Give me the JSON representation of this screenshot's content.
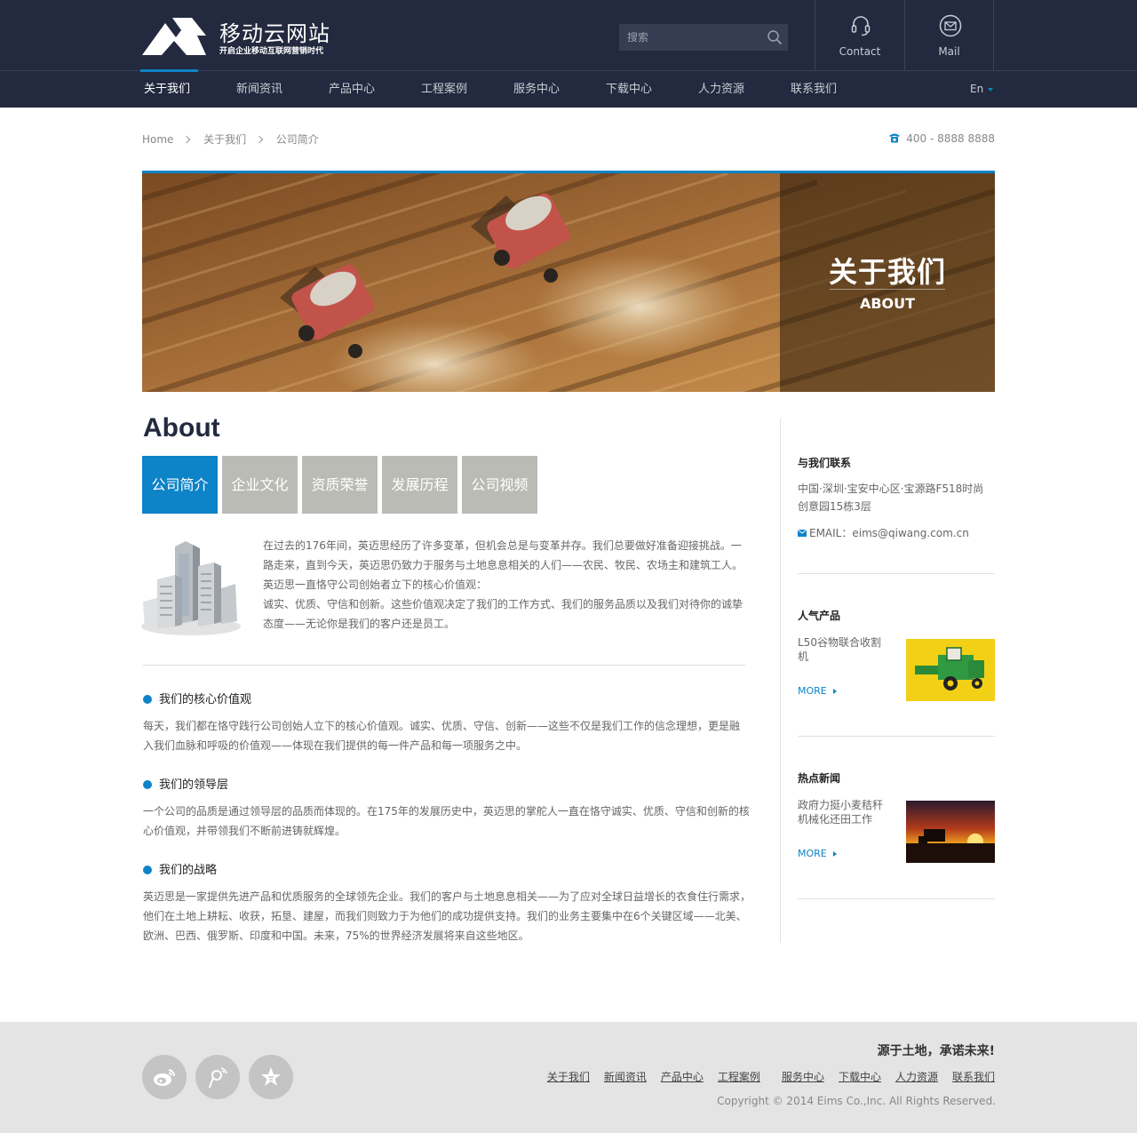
{
  "header": {
    "site_title": "移动云网站",
    "site_subtitle": "开启企业移动互联网营销时代",
    "search_placeholder": "搜索",
    "contact_label": "Contact",
    "mail_label": "Mail",
    "language": "En"
  },
  "nav": {
    "items": [
      {
        "label": "关于我们",
        "active": true
      },
      {
        "label": "新闻资讯"
      },
      {
        "label": "产品中心"
      },
      {
        "label": "工程案例"
      },
      {
        "label": "服务中心"
      },
      {
        "label": "下载中心"
      },
      {
        "label": "人力资源"
      },
      {
        "label": "联系我们"
      }
    ]
  },
  "breadcrumb": {
    "home": "Home",
    "level1": "关于我们",
    "level2": "公司简介"
  },
  "phone": "400 - 8888 8888",
  "banner": {
    "title": "关于我们",
    "subtitle": "ABOUT"
  },
  "main": {
    "heading": "About",
    "tabs": [
      "公司简介",
      "企业文化",
      "资质荣誉",
      "发展历程",
      "公司视频"
    ],
    "intro_lines": [
      "在过去的176年间，英迈思经历了许多变革，但机会总是与变革并存。我们总要做好准备迎接挑战。一",
      "路走来，直到今天，英迈思仍致力于服务与土地息息相关的人们——农民、牧民、农场主和建筑工人。",
      "英迈思一直恪守公司创始者立下的核心价值观：",
      "诚实、优质、守信和创新。这些价值观决定了我们的工作方式、我们的服务品质以及我们对待你的诚挚",
      "态度——无论你是我们的客户还是员工。"
    ],
    "sections": [
      {
        "title": "我们的核心价值观",
        "lines": [
          "每天，我们都在恪守践行公司创始人立下的核心价值观。诚实、优质、守信、创新——这些不仅是我们工作的信念理想，更是融",
          "入我们血脉和呼吸的价值观——体现在我们提供的每一件产品和每一项服务之中。"
        ]
      },
      {
        "title": "我们的领导层",
        "lines": [
          "一个公司的品质是通过领导层的品质而体现的。在175年的发展历史中，英迈思的掌舵人一直在恪守诚实、优质、守信和创新的核",
          "心价值观，并带领我们不断前进铸就辉煌。"
        ]
      },
      {
        "title": "我们的战略",
        "lines": [
          "英迈思是一家提供先进产品和优质服务的全球领先企业。我们的客户与土地息息相关——为了应对全球日益增长的衣食住行需求，",
          "他们在土地上耕耘、收获，拓垦、建屋，而我们则致力于为他们的成功提供支持。我们的业务主要集中在6个关键区域——北美、",
          "欧洲、巴西、俄罗斯、印度和中国。未来，75%的世界经济发展将来自这些地区。"
        ]
      }
    ]
  },
  "sidebar": {
    "contact_title": "与我们联系",
    "address_lines": [
      "中国·深圳·宝安中心区·宝源路F518时尚",
      "创意园15栋3层"
    ],
    "email": "EMAIL：eims@qiwang.com.cn",
    "products_title": "人气产品",
    "product_lines": [
      "L50谷物联合收割",
      "机"
    ],
    "product_more": "MORE",
    "news_title": "热点新闻",
    "news_lines": [
      "政府力挺小麦秸秆",
      "机械化还田工作"
    ],
    "news_more": "MORE"
  },
  "footer": {
    "slogan": "源于土地，承诺未来!",
    "links": [
      "关于我们",
      "新闻资讯",
      "产品中心",
      "工程案例",
      "服务中心",
      "下载中心",
      "人力资源",
      "联系我们"
    ],
    "copyright": "Copyright © 2014  Eims Co.,Inc. All Rights Reserved."
  },
  "colors": {
    "header_bg": "#232a3f",
    "accent": "#0d83c8",
    "tab_inactive": "#bbbbb5",
    "footer_bg": "#e4e4e4"
  },
  "icons": [
    "logo-mark",
    "search-icon",
    "headset-icon",
    "mail-icon",
    "phone-icon",
    "email-icon",
    "weibo-icon",
    "tencent-weibo-icon",
    "favorite-star-icon"
  ]
}
